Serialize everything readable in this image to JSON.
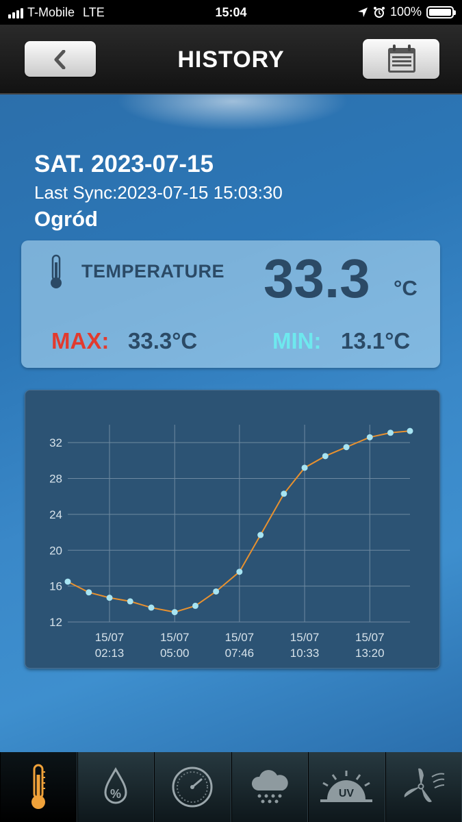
{
  "status_bar": {
    "carrier": "T-Mobile",
    "network": "LTE",
    "time": "15:04",
    "battery": "100%"
  },
  "header": {
    "title": "HISTORY",
    "back_icon": "chevron-left-icon",
    "calendar_icon": "calendar-icon"
  },
  "summary": {
    "date": "SAT. 2023-07-15",
    "last_sync": "Last Sync:2023-07-15 15:03:30",
    "location": "Ogród"
  },
  "temperature": {
    "label": "TEMPERATURE",
    "value": "33.3",
    "unit": "°C",
    "max_label": "MAX:",
    "max_value": "33.3°C",
    "min_label": "MIN:",
    "min_value": "13.1°C"
  },
  "chart_data": {
    "type": "line",
    "title": "",
    "xlabel": "",
    "ylabel": "",
    "ylim": [
      12,
      34
    ],
    "yticks": [
      12,
      16,
      20,
      24,
      28,
      32
    ],
    "xtick_labels": [
      {
        "date": "15/07",
        "time": "02:13"
      },
      {
        "date": "15/07",
        "time": "05:00"
      },
      {
        "date": "15/07",
        "time": "07:46"
      },
      {
        "date": "15/07",
        "time": "10:33"
      },
      {
        "date": "15/07",
        "time": "13:20"
      }
    ],
    "grid": true,
    "series": [
      {
        "color": "#e8912f",
        "marker_color": "#a7e4f2",
        "x": [
          "00:26",
          "01:20",
          "02:13",
          "03:06",
          "04:00",
          "05:00",
          "05:53",
          "06:46",
          "07:46",
          "08:40",
          "09:40",
          "10:33",
          "11:26",
          "12:20",
          "13:20",
          "14:13",
          "15:03"
        ],
        "values": [
          16.5,
          15.3,
          14.7,
          14.3,
          13.6,
          13.1,
          13.8,
          15.4,
          17.6,
          21.7,
          26.3,
          29.2,
          30.5,
          31.5,
          32.6,
          33.1,
          33.3
        ]
      }
    ]
  },
  "tabs": [
    {
      "name": "temperature",
      "icon": "thermometer-icon",
      "active": true
    },
    {
      "name": "humidity",
      "icon": "humidity-drop-icon",
      "active": false
    },
    {
      "name": "pressure",
      "icon": "barometer-icon",
      "active": false
    },
    {
      "name": "rain",
      "icon": "rain-cloud-icon",
      "active": false
    },
    {
      "name": "uv",
      "icon": "uv-sun-icon",
      "active": false
    },
    {
      "name": "wind",
      "icon": "wind-turbine-icon",
      "active": false
    }
  ]
}
